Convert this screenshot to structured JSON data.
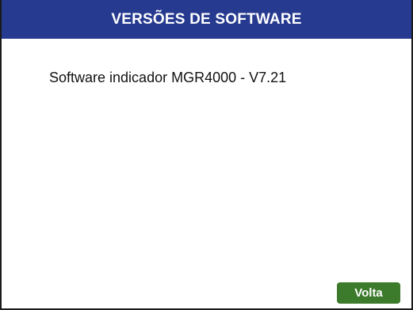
{
  "header": {
    "title": "VERSÕES DE SOFTWARE"
  },
  "content": {
    "software_line": "Software indicador MGR4000 - V7.21"
  },
  "footer": {
    "back_label": "Volta"
  },
  "colors": {
    "header_bg": "#263a8f",
    "button_bg": "#3c7a2c"
  }
}
